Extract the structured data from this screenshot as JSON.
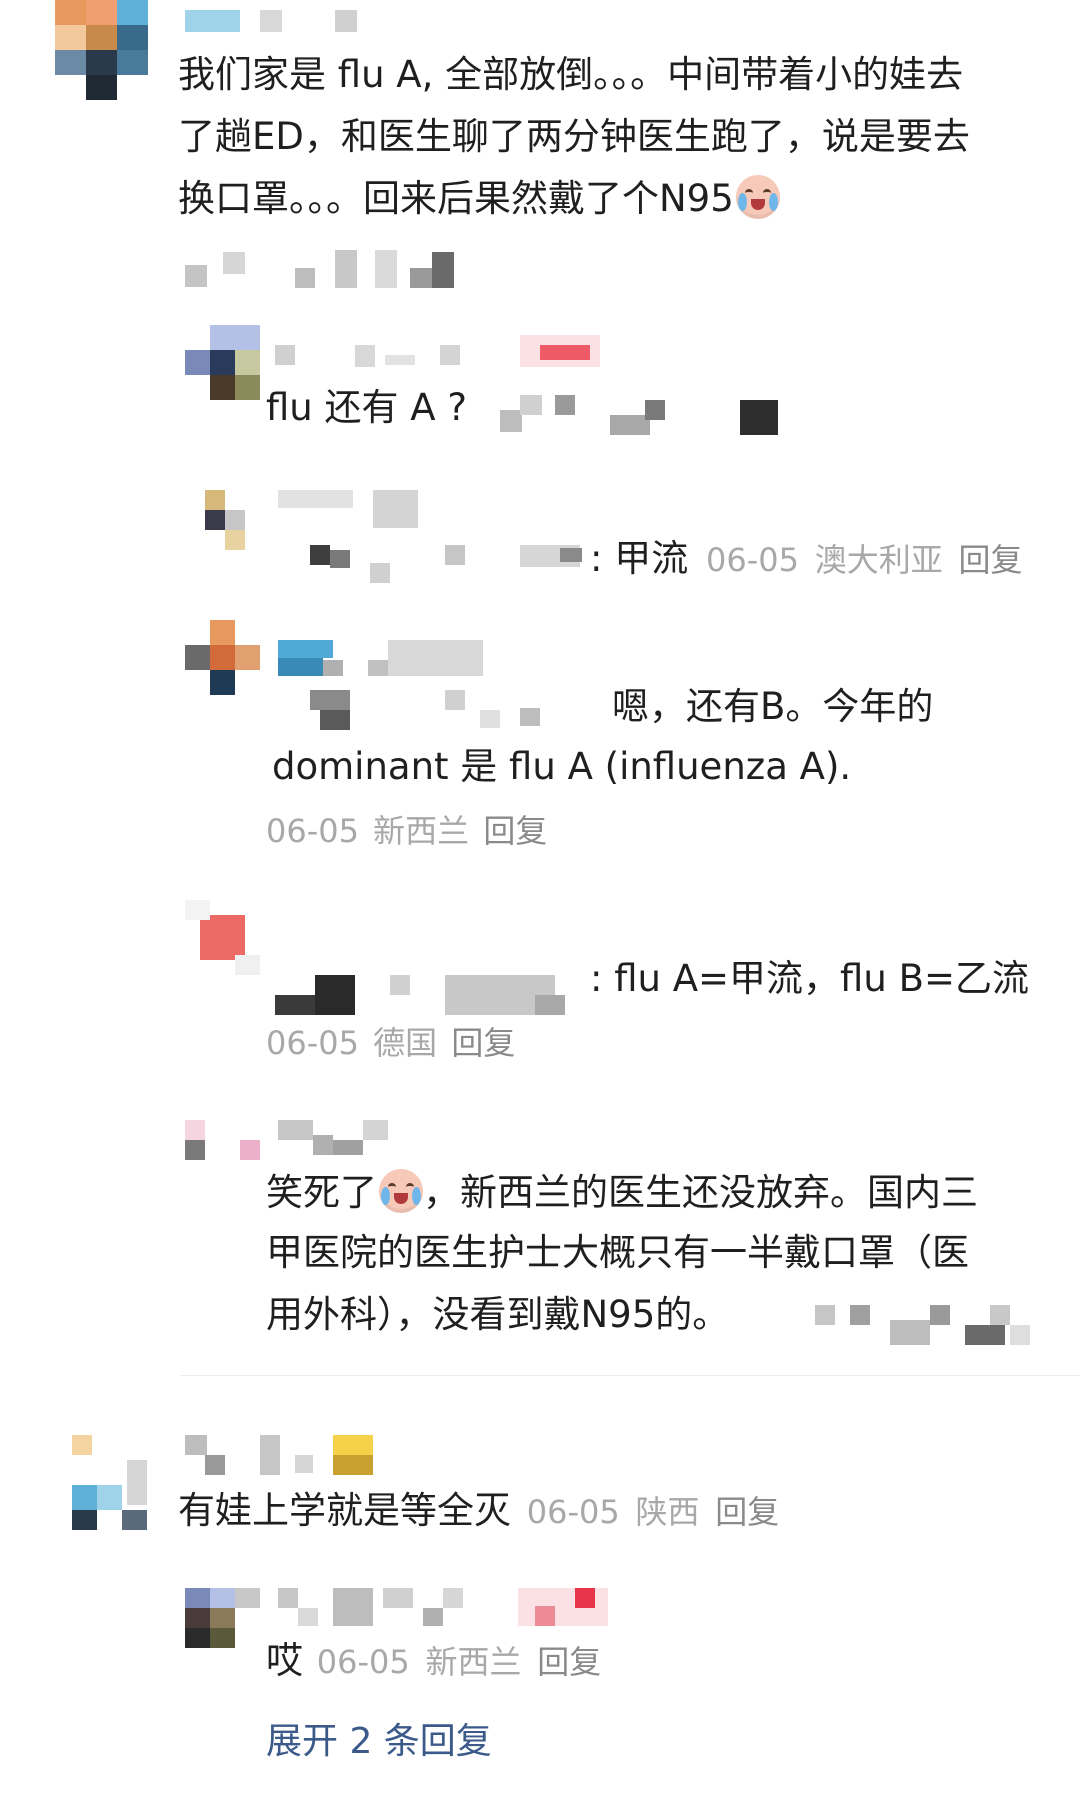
{
  "colors": {
    "text": "#1f1f1f",
    "meta": "#a8a8a8",
    "link": "#3b5a8a",
    "divider": "#ececec"
  },
  "comment1": {
    "line1": "我们家是 flu A, 全部放倒。。。中间带着小的娃去",
    "line2": "了趟ED，和医生聊了两分钟医生跑了，说是要去",
    "line3": "换口罩。。。回来后果然戴了个N95",
    "emoji": "crying-laugh-emoji"
  },
  "reply1": {
    "text": "flu 还有 A ?"
  },
  "reply2": {
    "text": ": 甲流",
    "date": "06-05",
    "location": "澳大利亚",
    "reply_label": "回复"
  },
  "reply3": {
    "line1": "嗯，还有B。今年的",
    "line2": "dominant 是 flu A (influenza A).",
    "date": "06-05",
    "location": "新西兰",
    "reply_label": "回复"
  },
  "reply4": {
    "text": ": flu A=甲流，flu B=乙流",
    "date": "06-05",
    "location": "德国",
    "reply_label": "回复"
  },
  "reply5": {
    "line1a": "笑死了",
    "line1b": "，新西兰的医生还没放弃。国内三",
    "line2": "甲医院的医生护士大概只有一半戴口罩（医",
    "line3": "用外科），没看到戴N95的。"
  },
  "comment2": {
    "text": "有娃上学就是等全灭",
    "date": "06-05",
    "location": "陕西",
    "reply_label": "回复"
  },
  "reply6": {
    "text": "哎",
    "date": "06-05",
    "location": "新西兰",
    "reply_label": "回复"
  },
  "expand_label": "展开 2 条回复"
}
